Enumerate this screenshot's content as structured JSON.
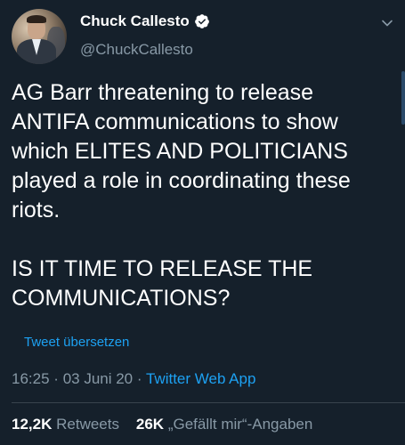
{
  "author": {
    "display_name": "Chuck Callesto",
    "handle": "@ChuckCallesto",
    "verified": true,
    "avatar_icon": "profile-photo"
  },
  "tweet": {
    "text": "AG Barr threatening to release\nANTIFA communications to show\nwhich ELITES AND POLITICIANS\nplayed a role in coordinating these\nriots.\n\nIS IT TIME TO RELEASE THE\nCOMMUNICATIONS?",
    "translate_label": "Tweet übersetzen",
    "time": "16:25",
    "date": "03 Juni 20",
    "separator": "·",
    "source": "Twitter Web App"
  },
  "stats": {
    "retweets_count": "12,2K",
    "retweets_label": "Retweets",
    "likes_count": "26K",
    "likes_label": "„Gefällt mir“-Angaben"
  },
  "colors": {
    "background": "#15202b",
    "text": "#ffffff",
    "secondary": "#8899a6",
    "link": "#1da1f2",
    "divider": "#38444d"
  }
}
